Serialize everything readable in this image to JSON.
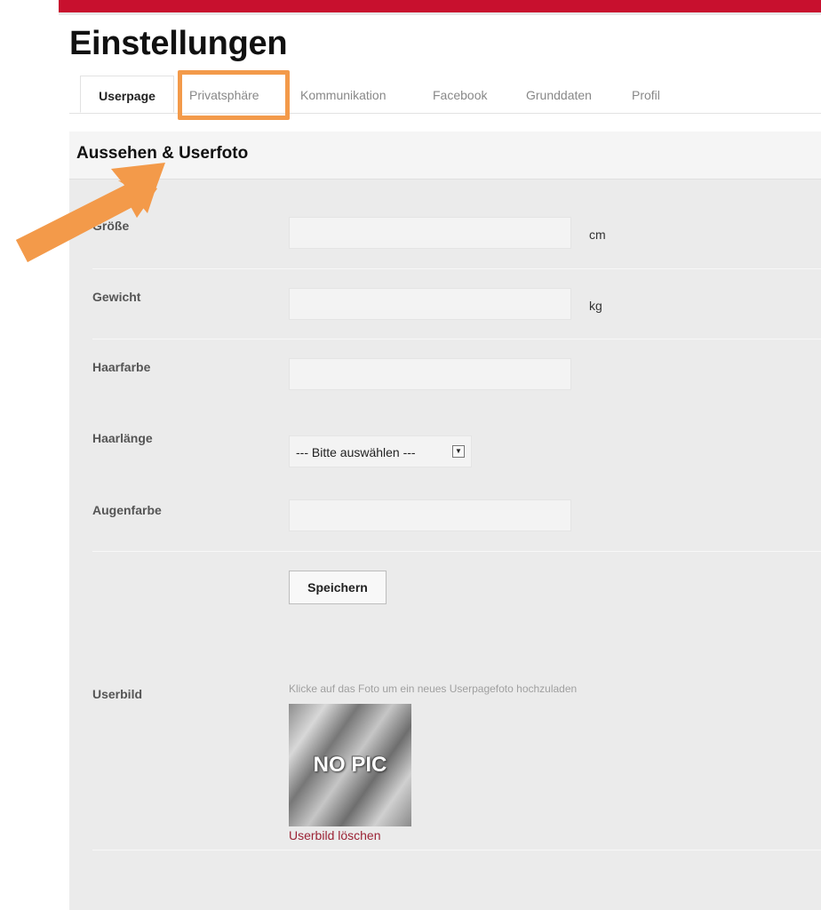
{
  "page": {
    "title": "Einstellungen"
  },
  "tabs": [
    {
      "label": "Userpage",
      "active": true
    },
    {
      "label": "Privatsphäre",
      "active": false
    },
    {
      "label": "Kommunikation",
      "active": false
    },
    {
      "label": "Facebook",
      "active": false
    },
    {
      "label": "Grunddaten",
      "active": false
    },
    {
      "label": "Profil",
      "active": false
    }
  ],
  "section": {
    "title": "Aussehen & Userfoto"
  },
  "form": {
    "groesse": {
      "label": "Größe",
      "value": "",
      "unit": "cm"
    },
    "gewicht": {
      "label": "Gewicht",
      "value": "",
      "unit": "kg"
    },
    "haarfarbe": {
      "label": "Haarfarbe",
      "value": ""
    },
    "haarlaenge": {
      "label": "Haarlänge",
      "selected": "--- Bitte auswählen ---"
    },
    "augenfarbe": {
      "label": "Augenfarbe",
      "value": ""
    },
    "save_label": "Speichern"
  },
  "userbild": {
    "label": "Userbild",
    "hint": "Klicke auf das Foto um ein neues Userpagefoto hochzuladen",
    "placeholder_text": "NO PIC",
    "delete_label": "Userbild löschen"
  },
  "annotation": {
    "arrow_color": "#f39a4a",
    "highlight_color": "#f39a4a",
    "highlighted_tab": "Privatsphäre"
  },
  "colors": {
    "brand_bar": "#c8102e",
    "link": "#9b2335",
    "panel": "#ebebeb"
  }
}
